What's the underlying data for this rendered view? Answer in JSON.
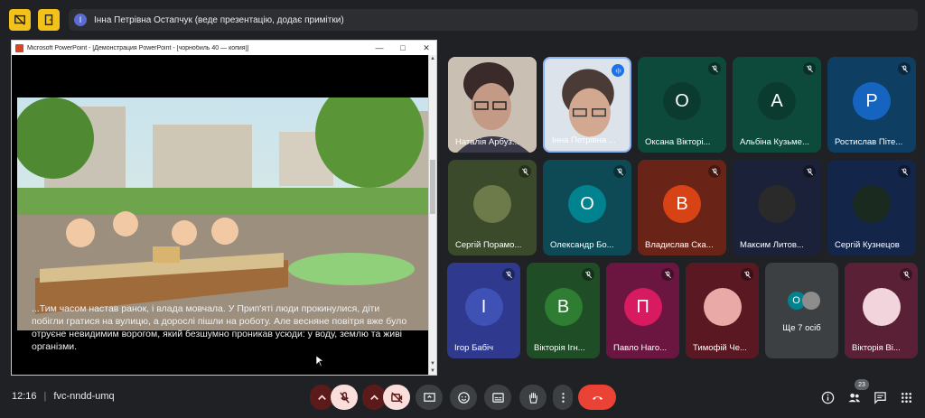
{
  "presenter": {
    "initial": "І",
    "text": "Інна Петрівна Остапчук (веде презентацію, додає примітки)"
  },
  "ppt": {
    "title": "Microsoft PowerPoint - [Демонстрация PowerPoint - [чорнобиль 40 — копия]]",
    "caption": "...Тим часом настав ранок, і влада мовчала. У Прип'яті люди прокинулися, діти побігли гратися на вулицю, а дорослі пішли на роботу. Але весняне повітря вже було отруєне невидимим ворогом, який безшумно проникав усюди: у воду, землю та живі організми."
  },
  "participants": [
    {
      "name": "Наталія Арбуз...",
      "initial": "",
      "bg": "#8a7c6e",
      "kind": "video1"
    },
    {
      "name": "Інна Петрівна ...",
      "initial": "",
      "bg": "#9aa6b2",
      "kind": "video2"
    },
    {
      "name": "Оксана Вікторі...",
      "initial": "О",
      "bg": "#0d4a3b",
      "av": "#0b3b2f"
    },
    {
      "name": "Альбіна Кузьме...",
      "initial": "А",
      "bg": "#0d4a3b",
      "av": "#0b3b2f"
    },
    {
      "name": "Ростислав Піте...",
      "initial": "Р",
      "bg": "#0e3e61",
      "av": "#1565c0"
    },
    {
      "name": "Сергій Порамо...",
      "initial": "",
      "bg": "#3b4a2a",
      "kind": "photo-nature"
    },
    {
      "name": "Олександр Бо...",
      "initial": "О",
      "bg": "#0d4a55",
      "av": "#00838f"
    },
    {
      "name": "Владислав Ска...",
      "initial": "В",
      "bg": "#6a2417",
      "av": "#d84315"
    },
    {
      "name": "Максим Литов...",
      "initial": "",
      "bg": "#1b2138",
      "kind": "photo-dark"
    },
    {
      "name": "Сергій Кузнецов",
      "initial": "",
      "bg": "#14254a",
      "kind": "photo-xmas"
    },
    {
      "name": "Ігор Бабіч",
      "initial": "І",
      "bg": "#2f3a8f",
      "av": "#3f51b5"
    },
    {
      "name": "Вікторія Ігн...",
      "initial": "В",
      "bg": "#1f4d26",
      "av": "#2e7d32"
    },
    {
      "name": "Павло Наго...",
      "initial": "П",
      "bg": "#6a1640",
      "av": "#d81b60"
    },
    {
      "name": "Тимофій Че...",
      "initial": "",
      "bg": "#5a1822",
      "kind": "photo-cartoon"
    },
    {
      "name": "Ще 7 осіб",
      "initial": "О",
      "bg": "#3c4043",
      "av": "#00838f",
      "kind": "more"
    },
    {
      "name": "Вікторія Ві...",
      "initial": "",
      "bg": "#5a2036",
      "kind": "photo-girl"
    }
  ],
  "bottom": {
    "time": "12:16",
    "code": "fvc-nndd-umq",
    "people_count": "23"
  },
  "colors": {
    "accent_yellow": "#f2c21b",
    "end_call_red": "#ea4335",
    "muted_pink": "#f9dedc"
  }
}
